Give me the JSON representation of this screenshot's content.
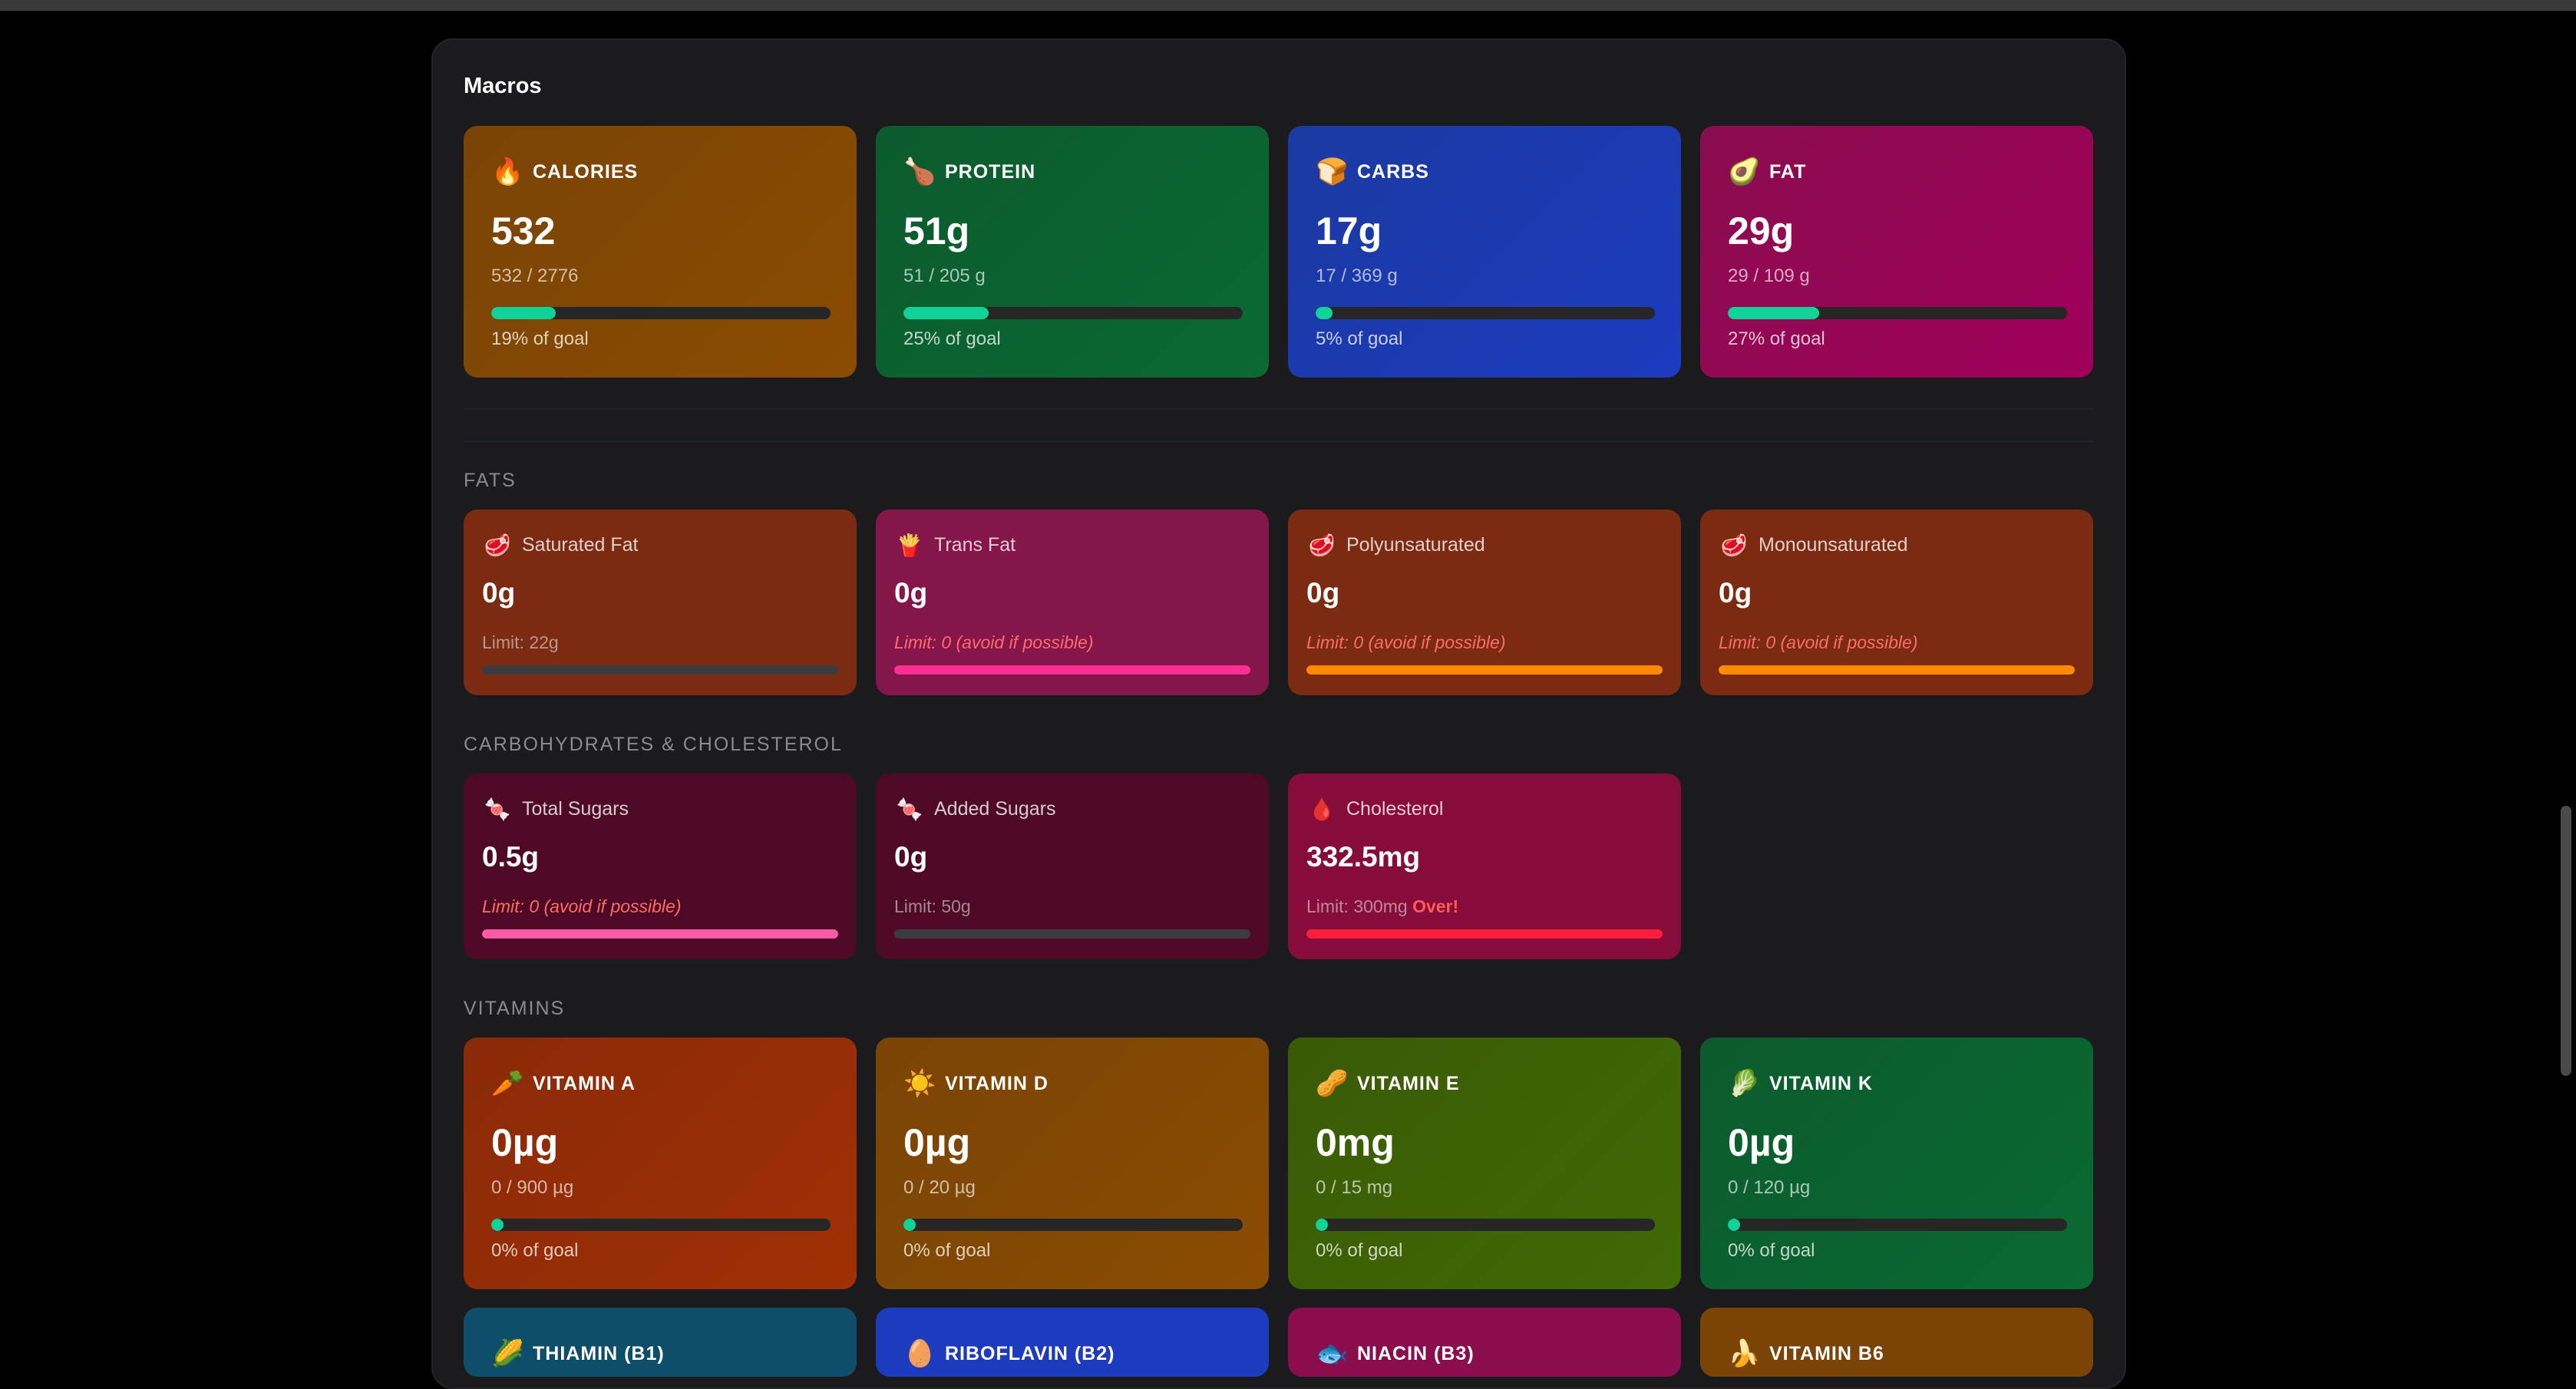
{
  "panel": {
    "title": "Macros"
  },
  "macros": [
    {
      "key": "calories",
      "icon": "🔥",
      "icon_name": "fire-icon",
      "label": "CALORIES",
      "value": "532",
      "sub": "532 / 2776",
      "fraction": 0.19,
      "pct": "19% of goal",
      "bg": "linear-gradient(135deg,#7a4406,#8a4c00)"
    },
    {
      "key": "protein",
      "icon": "🍗",
      "icon_name": "drumstick-icon",
      "label": "PROTEIN",
      "value": "51g",
      "sub": "51 / 205 g",
      "fraction": 0.25,
      "pct": "25% of goal",
      "bg": "linear-gradient(135deg,#0c5a2e,#0a6a32)"
    },
    {
      "key": "carbs",
      "icon": "🍞",
      "icon_name": "bread-icon",
      "label": "CARBS",
      "value": "17g",
      "sub": "17 / 369 g",
      "fraction": 0.05,
      "pct": "5% of goal",
      "bg": "linear-gradient(135deg,#1b3aa0,#1c3bbf)"
    },
    {
      "key": "fat",
      "icon": "🥑",
      "icon_name": "avocado-icon",
      "label": "FAT",
      "value": "29g",
      "sub": "29 / 109 g",
      "fraction": 0.27,
      "pct": "27% of goal",
      "bg": "linear-gradient(135deg,#8a0d4e,#a0005a)"
    }
  ],
  "sections": {
    "fats": "FATS",
    "carbs_chol": "CARBOHYDRATES & CHOLESTEROL",
    "vitamins": "VITAMINS"
  },
  "fats": [
    {
      "key": "saturated",
      "icon": "🥩",
      "icon_name": "meat-icon",
      "label": "Saturated Fat",
      "value": "0g",
      "limit": "Limit: 22g",
      "warn": false,
      "fraction": 0,
      "bar_color": "#3c3c40",
      "bg": "#7a2b12"
    },
    {
      "key": "trans",
      "icon": "🍟",
      "icon_name": "fries-icon",
      "label": "Trans Fat",
      "value": "0g",
      "limit": "Limit: 0 (avoid if possible)",
      "warn": true,
      "fraction": 1,
      "bar_color": "#ff2e93",
      "bg": "#85164a"
    },
    {
      "key": "poly",
      "icon": "🥩",
      "icon_name": "meat-icon",
      "label": "Polyunsaturated",
      "value": "0g",
      "limit": "Limit: 0 (avoid if possible)",
      "warn": true,
      "fraction": 1,
      "bar_color": "#ff8a00",
      "bg": "#7a2b12"
    },
    {
      "key": "mono",
      "icon": "🥩",
      "icon_name": "meat-icon",
      "label": "Monounsaturated",
      "value": "0g",
      "limit": "Limit: 0 (avoid if possible)",
      "warn": true,
      "fraction": 1,
      "bar_color": "#ff8a00",
      "bg": "#7a2b12"
    }
  ],
  "carbs_chol": [
    {
      "key": "total-sugars",
      "icon": "🍬",
      "icon_name": "candy-icon",
      "label": "Total Sugars",
      "value": "0.5g",
      "limit": "Limit: 0 (avoid if possible)",
      "warn": true,
      "fraction": 1,
      "bar_color": "#ff5aa8",
      "bg": "#4e0a24"
    },
    {
      "key": "added-sugars",
      "icon": "🍬",
      "icon_name": "candy-icon",
      "label": "Added Sugars",
      "value": "0g",
      "limit": "Limit: 50g",
      "warn": false,
      "fraction": 0,
      "bar_color": "#3c3c40",
      "bg": "#4e0a24"
    },
    {
      "key": "cholesterol",
      "icon": "🩸",
      "icon_name": "blood-drop-icon",
      "label": "Cholesterol",
      "value": "332.5mg",
      "limit": "Limit: 300mg",
      "over": "Over!",
      "warn": false,
      "fraction": 1,
      "bar_color": "#ff1f3d",
      "bg": "#860c3a"
    }
  ],
  "vitamins": [
    {
      "key": "vitamin-a",
      "icon": "🥕",
      "icon_name": "carrot-icon",
      "label": "VITAMIN A",
      "value": "0µg",
      "sub": "0 / 900 µg",
      "fraction": 0,
      "pct": "0% of goal",
      "bg": "linear-gradient(135deg,#8a2a08,#a03006)"
    },
    {
      "key": "vitamin-d",
      "icon": "☀️",
      "icon_name": "sun-icon",
      "label": "VITAMIN D",
      "value": "0µg",
      "sub": "0 / 20 µg",
      "fraction": 0,
      "pct": "0% of goal",
      "bg": "linear-gradient(135deg,#7a4406,#8a4c00)"
    },
    {
      "key": "vitamin-e",
      "icon": "🥜",
      "icon_name": "peanut-icon",
      "label": "VITAMIN E",
      "value": "0mg",
      "sub": "0 / 15 mg",
      "fraction": 0,
      "pct": "0% of goal",
      "bg": "linear-gradient(135deg,#3a5a06,#3f6a04)"
    },
    {
      "key": "vitamin-k",
      "icon": "🥬",
      "icon_name": "leafy-greens-icon",
      "label": "VITAMIN K",
      "value": "0µg",
      "sub": "0 / 120 µg",
      "fraction": 0,
      "pct": "0% of goal",
      "bg": "linear-gradient(135deg,#0c5a2e,#0a6a32)"
    }
  ],
  "vitamins_b": [
    {
      "key": "thiamin",
      "icon": "🌽",
      "icon_name": "corn-icon",
      "label": "THIAMIN (B1)",
      "bg": "#0e4e6a"
    },
    {
      "key": "riboflavin",
      "icon": "🥚",
      "icon_name": "egg-icon",
      "label": "RIBOFLAVIN (B2)",
      "bg": "#1c3bbf"
    },
    {
      "key": "niacin",
      "icon": "🐟",
      "icon_name": "fish-icon",
      "label": "NIACIN (B3)",
      "bg": "#8a0d4e"
    },
    {
      "key": "vitamin-b6",
      "icon": "🍌",
      "icon_name": "banana-icon",
      "label": "VITAMIN B6",
      "bg": "#7a4406"
    }
  ]
}
